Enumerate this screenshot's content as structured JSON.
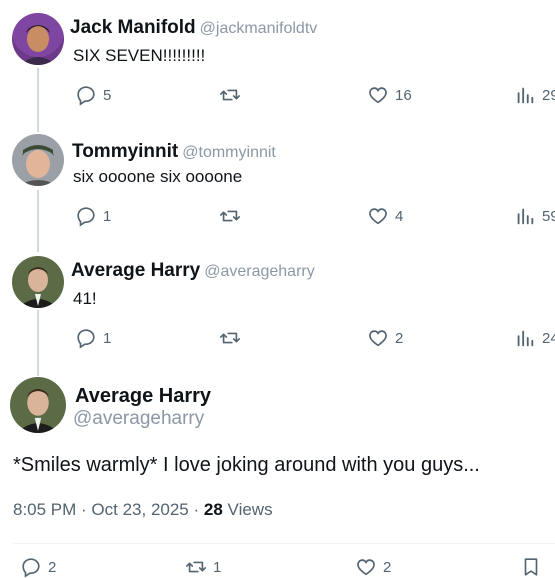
{
  "replies": [
    {
      "display_name": "Jack Manifold",
      "handle": "@jackmanifoldtv",
      "text": "SIX SEVEN!!!!!!!!!",
      "replies": "5",
      "reposts": "",
      "likes": "16",
      "views": "29"
    },
    {
      "display_name": "Tommyinnit",
      "handle": "@tommyinnit",
      "text": "six oooone six oooone",
      "replies": "1",
      "reposts": "",
      "likes": "4",
      "views": "59"
    },
    {
      "display_name": "Average Harry",
      "handle": "@averageharry",
      "text": "41!",
      "replies": "1",
      "reposts": "",
      "likes": "2",
      "views": "24"
    }
  ],
  "main_tweet": {
    "display_name": "Average Harry",
    "handle": "@averageharry",
    "text": "*Smiles warmly* I love joking around with you guys...",
    "time": "8:05 PM",
    "date": "Oct 23, 2025",
    "views_count": "28",
    "views_label": "Views",
    "bottom_replies": "2",
    "bottom_reposts": "1",
    "bottom_likes": "2"
  },
  "icons": {
    "reply": "reply-icon",
    "repost": "repost-icon",
    "like": "heart-icon",
    "views": "views-icon",
    "bookmark": "bookmark-icon"
  },
  "colors": {
    "text_primary": "#0f1419",
    "text_secondary": "#536471",
    "handle": "#8b98a5",
    "thread_line": "#cfd9de"
  }
}
